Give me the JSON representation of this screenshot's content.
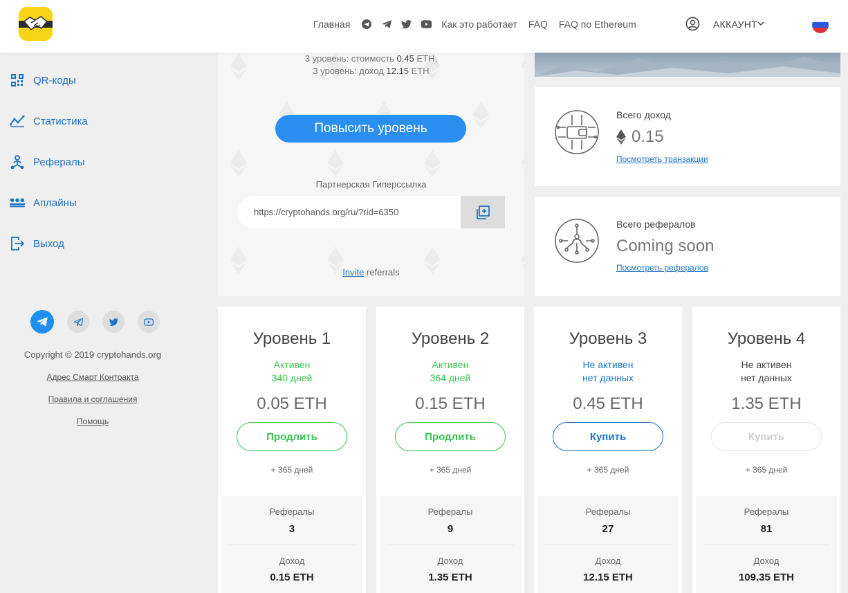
{
  "colors": {
    "accent": "#2a8ff0",
    "link": "#1c73c9",
    "active_green": "#3cc451",
    "inactive_blue": "#1c73c9",
    "logo_yellow": "#f7d417"
  },
  "header": {
    "nav": {
      "home": "Главная",
      "how_it_works": "Как это работает",
      "faq": "FAQ",
      "faq_eth": "FAQ по Ethereum"
    },
    "social_icons": [
      "telegram-round-icon",
      "telegram-icon",
      "twitter-icon",
      "youtube-icon"
    ],
    "account_label": "АККАУНТ"
  },
  "sidebar": {
    "items": [
      {
        "label": "QR-коды",
        "icon": "qr-icon"
      },
      {
        "label": "Статистика",
        "icon": "stats-icon"
      },
      {
        "label": "Рефералы",
        "icon": "referrals-icon"
      },
      {
        "label": "Аплайны",
        "icon": "uplines-icon"
      },
      {
        "label": "Выход",
        "icon": "logout-icon"
      }
    ],
    "copyright": "Copyright © 2019 cryptohands.org",
    "links": {
      "contract": "Адрес Смарт Контракта",
      "rules": "Правила и соглашения",
      "help": "Помощь"
    }
  },
  "referral_panel": {
    "level3_cost_prefix": "3 уровень: стоимость ",
    "level3_cost_value": "0.45",
    "level3_cost_suffix": " ETH,",
    "level3_income_prefix": "3 уровень: доход ",
    "level3_income_value": "12.15",
    "level3_income_suffix": " ETH",
    "raise_button": "Повысить уровень",
    "partner_label": "Партнерская Гиперссылка",
    "ref_link": "https://cryptohands.org/ru/?rid=6350",
    "invite_link": "Invite",
    "invite_suffix": " referrals"
  },
  "income_card": {
    "label": "Всего доход",
    "value": "0.15",
    "link": "Посмотреть транзакции"
  },
  "referrals_card": {
    "label": "Всего рефералов",
    "value": "Coming soon",
    "link": "Посмотреть рефералов"
  },
  "levels": [
    {
      "title": "Уровень 1",
      "status": "Активен",
      "days": "340 дней",
      "price": "0.05 ETH",
      "button": "Продлить",
      "extend": "+ 365 дней",
      "ref_label": "Рефералы",
      "ref_value": "3",
      "income_label": "Доход",
      "income_value": "0.15 ETH"
    },
    {
      "title": "Уровень 2",
      "status": "Активен",
      "days": "364 дней",
      "price": "0.15 ETH",
      "button": "Продлить",
      "extend": "+ 365 дней",
      "ref_label": "Рефералы",
      "ref_value": "9",
      "income_label": "Доход",
      "income_value": "1.35 ETH"
    },
    {
      "title": "Уровень 3",
      "status": "Не активен",
      "days": "нет данных",
      "price": "0.45 ETH",
      "button": "Купить",
      "extend": "+ 365 дней",
      "ref_label": "Рефералы",
      "ref_value": "27",
      "income_label": "Доход",
      "income_value": "12.15 ETH"
    },
    {
      "title": "Уровень 4",
      "status": "Не активен",
      "days": "нет данных",
      "price": "1.35 ETH",
      "button": "Купить",
      "extend": "+ 365 дней",
      "ref_label": "Рефералы",
      "ref_value": "81",
      "income_label": "Доход",
      "income_value": "109.35 ETH"
    }
  ]
}
